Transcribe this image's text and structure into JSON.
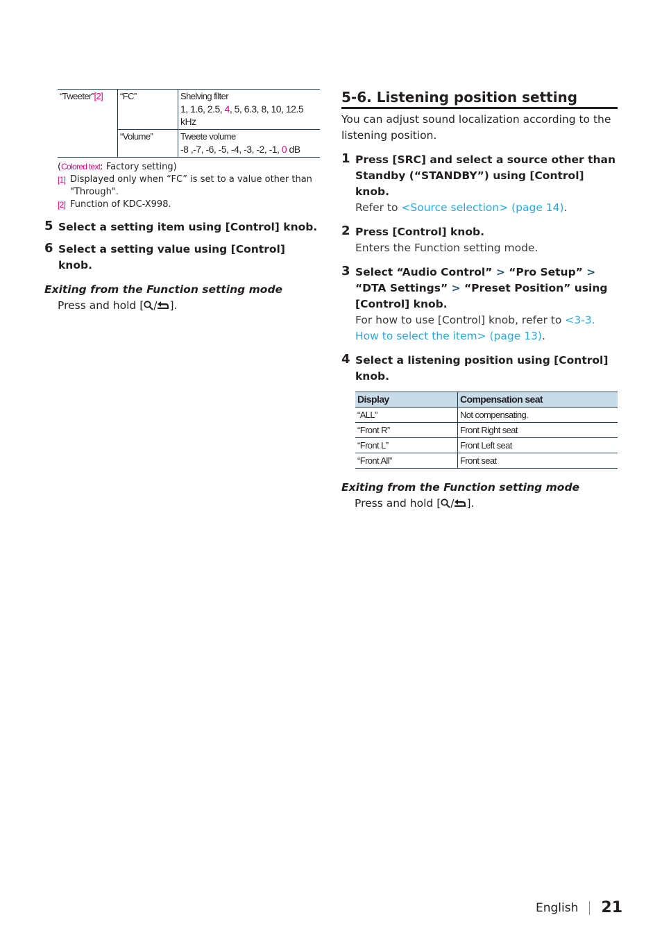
{
  "left": {
    "table": {
      "param": "“Tweeter”",
      "param_ref": "[2]",
      "rows": [
        {
          "item": "“FC”",
          "desc": "Shelving filter",
          "values_before": "1, 1.6, 2.5, ",
          "values_default": "4",
          "values_after": ", 5, 6.3, 8, 10, 12.5 kHz"
        },
        {
          "item": "“Volume”",
          "desc": "Tweete volume",
          "values_before": "-8 ,-7, -6, -5, -4, -3, -2, -1, ",
          "values_default": "0",
          "values_after": " dB"
        }
      ]
    },
    "notes": {
      "colored_open": "(",
      "colored_label": "Colored text",
      "colored_rest": ": Factory setting)",
      "items": [
        {
          "mark": "[1]",
          "text": "Displayed only when “FC” is set to a value other than \"Through\"."
        },
        {
          "mark": "[2]",
          "text": "Function of KDC-X998."
        }
      ]
    },
    "steps": [
      {
        "num": "5",
        "title": "Select a setting item using [Control] knob."
      },
      {
        "num": "6",
        "title": "Select a setting value using [Control] knob."
      }
    ],
    "exit": {
      "heading": "Exiting from the Function setting mode",
      "text_before": "Press and hold [",
      "text_after": "]."
    }
  },
  "right": {
    "section_title": "5-6.  Listening position setting",
    "intro": "You can adjust sound localization according to the listening position.",
    "steps": [
      {
        "num": "1",
        "title": "Press [SRC] and select a source other than Standby (“STANDBY”) using [Control] knob.",
        "desc_before": "Refer to ",
        "desc_link": "<Source selection> (page 14)",
        "desc_after": "."
      },
      {
        "num": "2",
        "title": "Press [Control] knob.",
        "desc": "Enters the Function setting mode."
      },
      {
        "num": "3",
        "title_parts": [
          "Select “Audio Control” ",
          " “Pro Setup” ",
          " “DTA Settings” ",
          " “Preset Position” using [Control] knob."
        ],
        "arrow": ">",
        "desc_before": "For how to use [Control] knob, refer to ",
        "desc_link": "<3-3. How to select the item> (page 13)",
        "desc_after": "."
      },
      {
        "num": "4",
        "title": "Select a listening position using [Control] knob."
      }
    ],
    "table": {
      "headers": [
        "Display",
        "Compensation seat"
      ],
      "rows": [
        [
          "“ALL”",
          "Not compensating."
        ],
        [
          "“Front R”",
          "Front Right seat"
        ],
        [
          "“Front L”",
          "Front Left seat"
        ],
        [
          "“Front All”",
          "Front seat"
        ]
      ]
    },
    "exit": {
      "heading": "Exiting from the Function setting mode",
      "text_before": "Press and hold [",
      "text_after": "]."
    }
  },
  "footer": {
    "language": "English",
    "page_number": "21"
  },
  "colors": {
    "default_value": "#e6007e",
    "link": "#29a8e0",
    "table_header_bg": "#c8dbe8",
    "rule": "#1d3b50"
  }
}
